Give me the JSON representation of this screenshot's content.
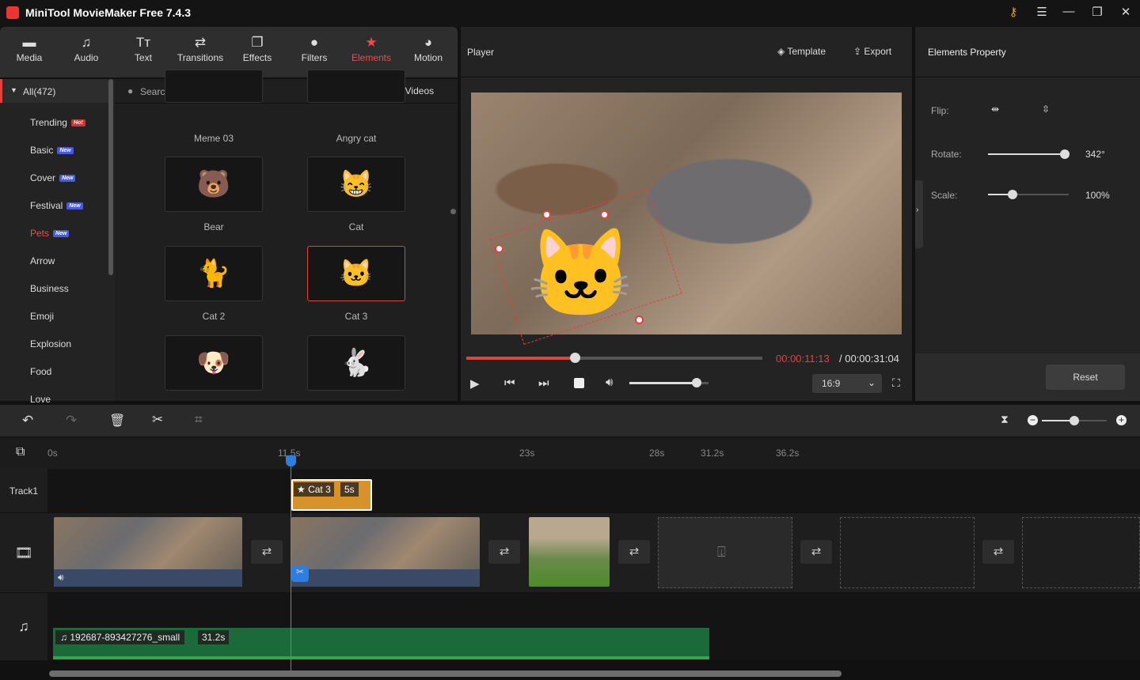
{
  "app": {
    "title": "MiniTool MovieMaker Free 7.4.3"
  },
  "window": {
    "icons": [
      "key-icon",
      "menu-icon",
      "minimize-icon",
      "maximize-icon",
      "close-icon"
    ]
  },
  "toolbar": [
    {
      "label": "Media",
      "icon": "▬"
    },
    {
      "label": "Audio",
      "icon": "♫"
    },
    {
      "label": "Text",
      "icon": "Tт"
    },
    {
      "label": "Transitions",
      "icon": "⇄"
    },
    {
      "label": "Effects",
      "icon": "❐"
    },
    {
      "label": "Filters",
      "icon": "●"
    },
    {
      "label": "Elements",
      "icon": "★"
    },
    {
      "label": "Motion",
      "icon": "◕"
    }
  ],
  "active_tool": "Elements",
  "accent": "#f04a4a",
  "categories": {
    "all": "All(472)",
    "items": [
      {
        "label": "Trending",
        "badge": "Hot",
        "badge_color": "#d83030"
      },
      {
        "label": "Basic",
        "badge": "New",
        "badge_color": "#4a5ae0"
      },
      {
        "label": "Cover",
        "badge": "New",
        "badge_color": "#4a5ae0"
      },
      {
        "label": "Festival",
        "badge": "New",
        "badge_color": "#4a5ae0"
      },
      {
        "label": "Pets",
        "badge": "New",
        "badge_color": "#4a5ae0"
      },
      {
        "label": "Arrow"
      },
      {
        "label": "Business"
      },
      {
        "label": "Emoji"
      },
      {
        "label": "Explosion"
      },
      {
        "label": "Food"
      },
      {
        "label": "Love"
      }
    ],
    "selected": "Pets"
  },
  "search": {
    "placeholder": "Search elements",
    "download": "Download YouTube Videos"
  },
  "elements": [
    {
      "label": "Meme 03"
    },
    {
      "label": "Angry cat"
    },
    {
      "label": "Bear",
      "glyph": "🐻"
    },
    {
      "label": "Cat",
      "glyph": "😸"
    },
    {
      "label": "Cat 2",
      "glyph": "🐈"
    },
    {
      "label": "Cat 3",
      "glyph": "🐱",
      "selected": true
    },
    {
      "label": "",
      "glyph": "🐶"
    },
    {
      "label": "",
      "glyph": "🐇"
    }
  ],
  "player": {
    "title": "Player",
    "template": "Template",
    "export": "Export",
    "current_time": "00:00:11:13",
    "total_time": "/ 00:00:31:04",
    "progress": 0.365,
    "volume": 0.85,
    "aspect": "16:9"
  },
  "properties": {
    "title": "Elements Property",
    "flip_label": "Flip:",
    "rotate_label": "Rotate:",
    "rotate_value": "342°",
    "rotate_fraction": 0.95,
    "scale_label": "Scale:",
    "scale_value": "100%",
    "scale_fraction": 0.3,
    "reset": "Reset"
  },
  "timeline": {
    "ticks": [
      "0s",
      "11.5s",
      "23s",
      "28s",
      "31.2s",
      "36.2s"
    ],
    "track1": "Track1",
    "element_clip": {
      "name": "Cat 3",
      "duration": "5s"
    },
    "audio_clip": {
      "name": "192687-893427276_small",
      "duration": "31.2s"
    },
    "zoom": 0.5
  }
}
